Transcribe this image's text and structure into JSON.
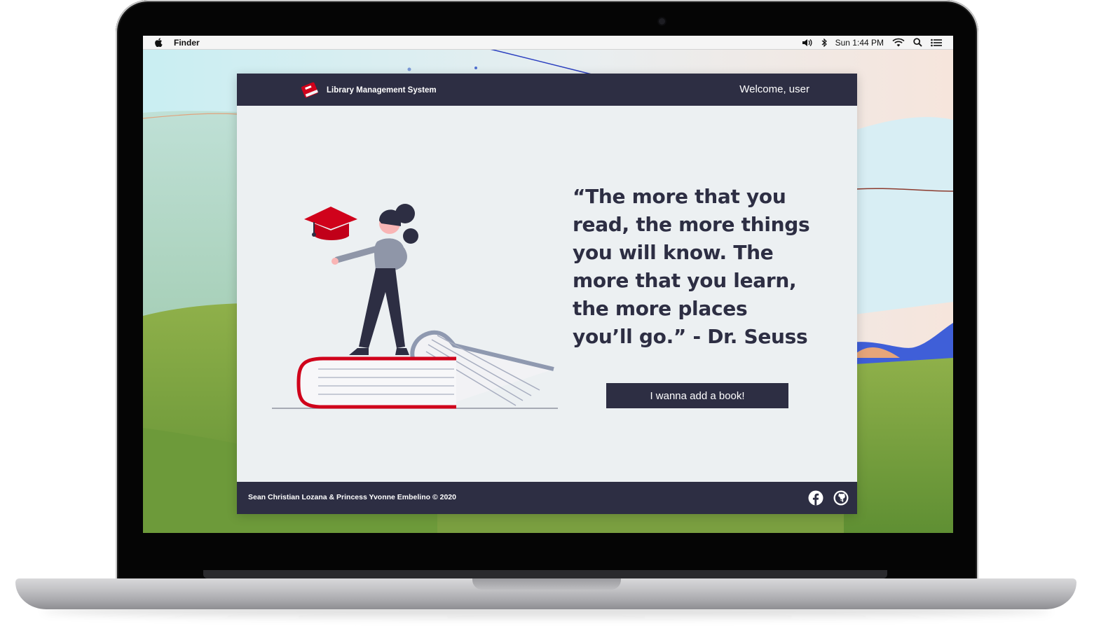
{
  "menubar": {
    "app_name": "Finder",
    "clock": "Sun 1:44 PM",
    "icons": [
      "apple-icon",
      "volume-icon",
      "bluetooth-icon",
      "wifi-icon",
      "spotlight-search-icon",
      "notification-center-icon"
    ]
  },
  "app": {
    "header": {
      "title": "Library Management System",
      "welcome": "Welcome, user"
    },
    "main": {
      "quote": "“The more that you read, the more things you will know. The more that you learn, the more places you’ll go.” - Dr. Seuss",
      "cta_label": "I wanna add a book!"
    },
    "footer": {
      "credits": "Sean Christian Lozana & Princess Yvonne Embelino © 2020",
      "social_icons": [
        "facebook-icon",
        "github-icon"
      ]
    }
  },
  "colors": {
    "navy": "#2d2e43",
    "accent_red": "#d0021b",
    "page_bg": "#ecf0f2"
  }
}
